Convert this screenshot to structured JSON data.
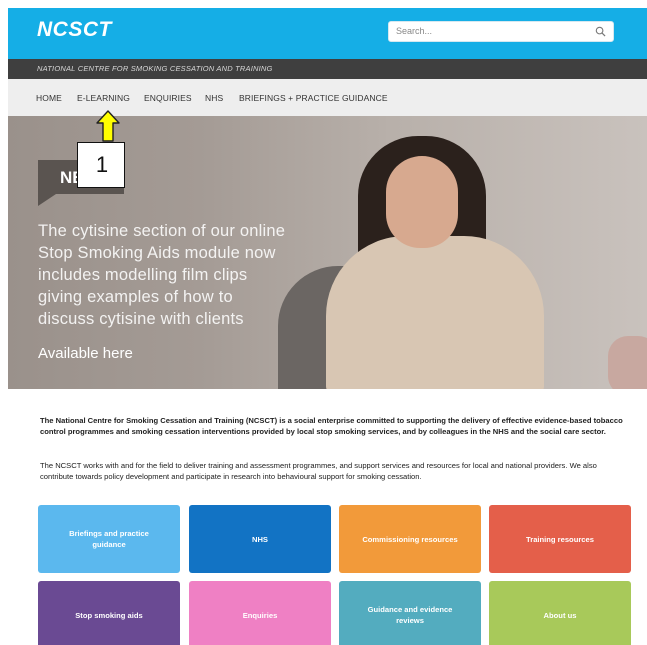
{
  "header": {
    "logo": "NCSCT",
    "search_placeholder": "Search...",
    "tagline": "NATIONAL CENTRE FOR SMOKING CESSATION AND TRAINING"
  },
  "nav": {
    "items": [
      {
        "label": "HOME"
      },
      {
        "label": "E-LEARNING"
      },
      {
        "label": "ENQUIRIES"
      },
      {
        "label": "NHS"
      },
      {
        "label": "BRIEFINGS + PRACTICE GUIDANCE"
      }
    ]
  },
  "hero": {
    "badge": "NE",
    "lines": [
      "The cytisine section of our online",
      "Stop Smoking Aids module now",
      "includes modelling film clips",
      "giving examples of how to",
      "discuss cytisine with clients"
    ],
    "cta": "Available here"
  },
  "callout": {
    "number": "1",
    "arrow_color": "#ffff00"
  },
  "intro": {
    "p1": "The National Centre for Smoking Cessation and Training (NCSCT) is a social enterprise committed to supporting the delivery of effective evidence-based tobacco control programmes and smoking cessation interventions provided by local stop smoking services, and by colleagues in the NHS and the social care sector.",
    "p2": "The NCSCT works with and for the field to deliver training and assessment programmes, and support services and resources for local and national providers. We also contribute towards policy development and participate in research into behavioural support for smoking cessation."
  },
  "tiles": [
    {
      "label": "Briefings and practice guidance",
      "color": "#5bb8ee"
    },
    {
      "label": "NHS",
      "color": "#1273c4"
    },
    {
      "label": "Commissioning resources",
      "color": "#f29a3a"
    },
    {
      "label": "Training resources",
      "color": "#e45f4a"
    },
    {
      "label": "Stop smoking aids",
      "color": "#6a4a93"
    },
    {
      "label": "Enquiries",
      "color": "#ef80c4"
    },
    {
      "label": "Guidance and evidence reviews",
      "color": "#53acbf"
    },
    {
      "label": "About us",
      "color": "#a8c95a"
    }
  ],
  "colors": {
    "brand_blue": "#15aee6",
    "tagline_bar": "#3f3f3f",
    "nav_bg": "#eeeeee"
  }
}
